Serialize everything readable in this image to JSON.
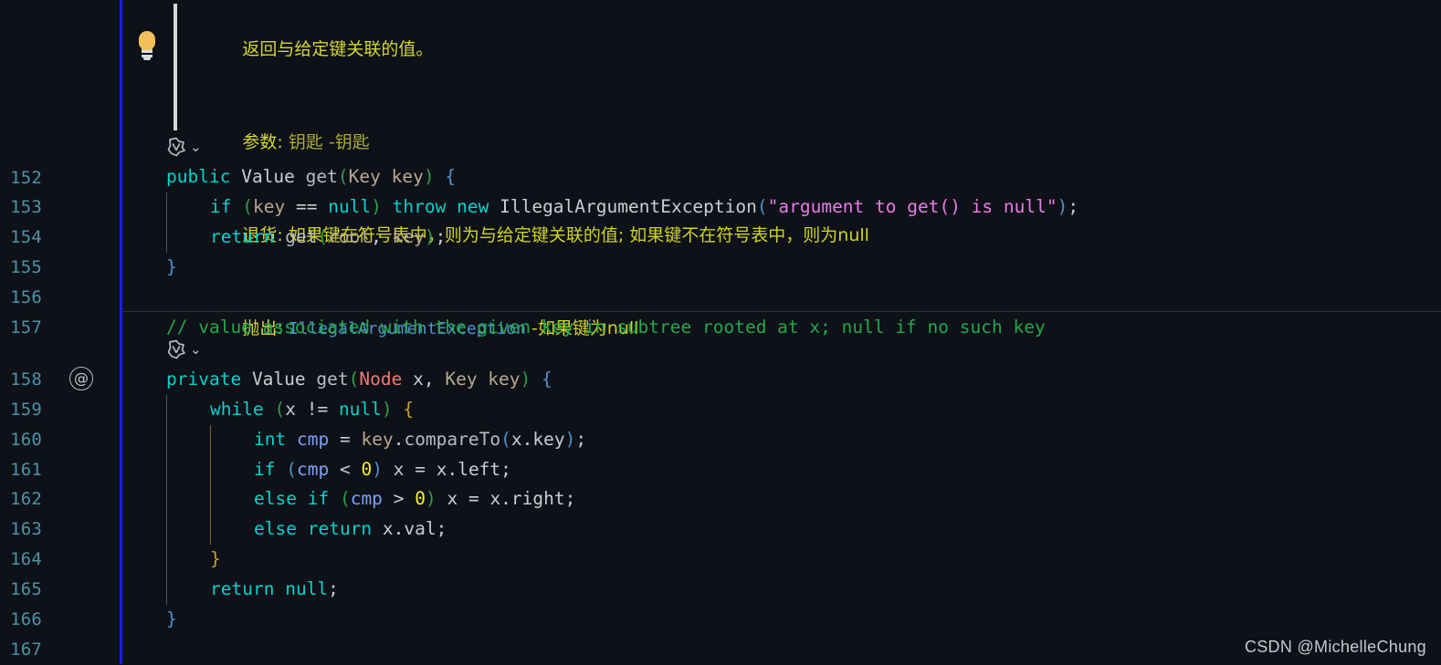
{
  "editor": {
    "theme_background": "#0e1117",
    "line_number_color": "#4a93a8",
    "diff_bar_color": "#1b1bff"
  },
  "hover_doc": {
    "icon": "lightbulb-icon",
    "lines": [
      {
        "id": "summary",
        "text": "返回与给定键关联的值。"
      },
      {
        "id": "params",
        "tag": "参数:",
        "body": " 钥匙 -钥匙"
      },
      {
        "id": "returns",
        "tag": "退货:",
        "body": " 如果键在符号表中，则为与给定键关联的值; 如果键不在符号表中，则为null"
      },
      {
        "id": "throws",
        "tag": "抛出:",
        "link": "IllegalArgumentException",
        "body": " -如果键为null"
      }
    ]
  },
  "codelens": [
    {
      "id": "lens-152",
      "icon": "codelens-refactor-icon",
      "chevron": "⌄"
    },
    {
      "id": "lens-158",
      "icon": "codelens-refactor-icon",
      "chevron": "⌄"
    }
  ],
  "gutter": {
    "line_numbers": [
      "152",
      "153",
      "154",
      "155",
      "156",
      "157",
      "158",
      "159",
      "160",
      "161",
      "162",
      "163",
      "164",
      "165",
      "166",
      "167"
    ],
    "annotation_marker": {
      "line": "158",
      "glyph": "@",
      "name": "javadoc-annotation-marker"
    }
  },
  "code_lines": {
    "l152": {
      "number": "152",
      "text": "public Value get(Key key) {"
    },
    "l153": {
      "number": "153",
      "text": "    if (key == null) throw new IllegalArgumentException(\"argument to get() is null\");"
    },
    "l154": {
      "number": "154",
      "text": "    return get(root, key);"
    },
    "l155": {
      "number": "155",
      "text": "}"
    },
    "l156": {
      "number": "156",
      "text": ""
    },
    "l157": {
      "number": "157",
      "text": "    // value associated with the given key in subtree rooted at x; null if no such key"
    },
    "l158": {
      "number": "158",
      "text": "private Value get(Node x, Key key) {"
    },
    "l159": {
      "number": "159",
      "text": "    while (x != null) {"
    },
    "l160": {
      "number": "160",
      "text": "        int cmp = key.compareTo(x.key);"
    },
    "l161": {
      "number": "161",
      "text": "        if (cmp < 0) x = x.left;"
    },
    "l162": {
      "number": "162",
      "text": "        else if (cmp > 0) x = x.right;"
    },
    "l163": {
      "number": "163",
      "text": "        else return x.val;"
    },
    "l164": {
      "number": "164",
      "text": "    }"
    },
    "l165": {
      "number": "165",
      "text": "    return null;"
    },
    "l166": {
      "number": "166",
      "text": "}"
    },
    "l167": {
      "number": "167",
      "text": ""
    }
  },
  "watermark": {
    "text": "CSDN @MichelleChung"
  }
}
